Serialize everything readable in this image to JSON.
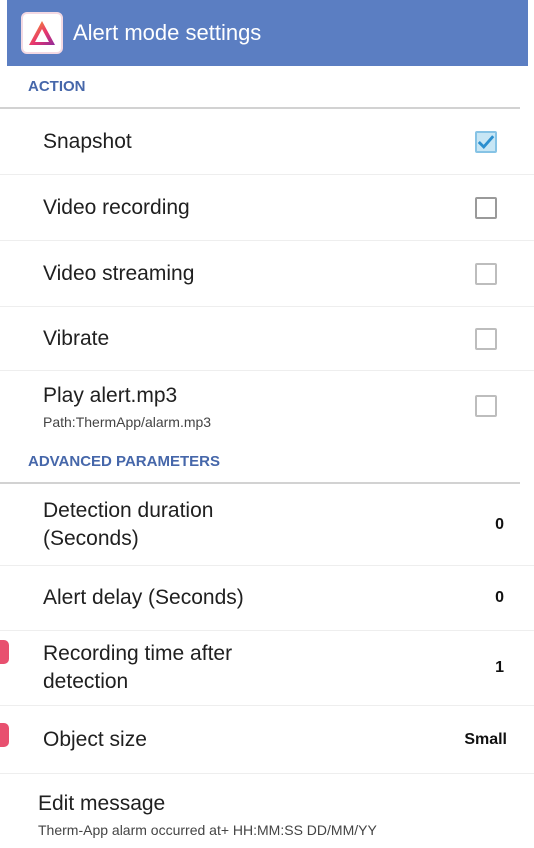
{
  "app_bar": {
    "title": "Alert mode settings",
    "icon": "thermapp-logo-icon",
    "background": "#5b7ec2"
  },
  "categories": {
    "action": "ACTION",
    "advanced": "ADVANCED PARAMETERS"
  },
  "action_items": [
    {
      "title": "Snapshot",
      "checked": true
    },
    {
      "title": "Video recording",
      "checked": false
    },
    {
      "title": "Video streaming",
      "checked": false
    },
    {
      "title": "Vibrate",
      "checked": false
    },
    {
      "title": "Play alert.mp3",
      "summary": "Path:ThermApp/alarm.mp3",
      "checked": false
    }
  ],
  "advanced_items": [
    {
      "title_line1": "Detection duration",
      "title_line2": "(Seconds)",
      "value": "0"
    },
    {
      "title": "Alert delay (Seconds)",
      "value": "0"
    },
    {
      "title_line1": "Recording time after",
      "title_line2": "detection",
      "value": "1"
    },
    {
      "title": "Object size",
      "value": "Small"
    }
  ],
  "edit_message": {
    "title": "Edit message",
    "summary": "Therm-App alarm occurred at+ HH:MM:SS DD/MM/YY"
  },
  "colors": {
    "accent": "#4667aa",
    "check": "#2b8fcf",
    "side_marker": "#e8506f"
  }
}
